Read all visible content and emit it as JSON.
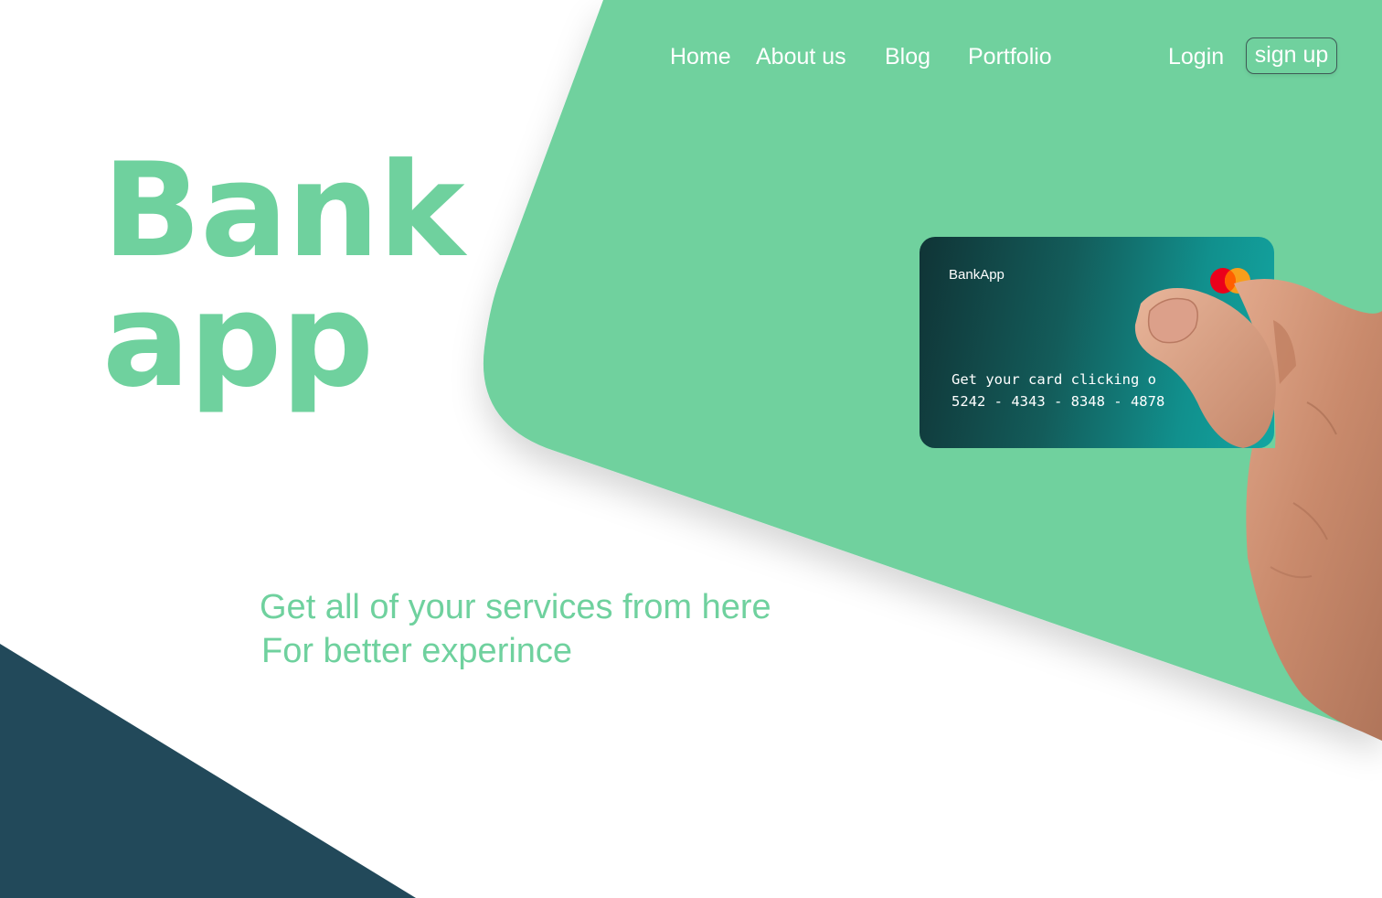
{
  "colors": {
    "accent_green": "#6fd19e",
    "dark_teal": "#22495a",
    "white": "#ffffff"
  },
  "nav": {
    "items": [
      {
        "label": "Home"
      },
      {
        "label": "About us"
      },
      {
        "label": "Blog"
      },
      {
        "label": "Portfolio"
      }
    ],
    "login_label": "Login",
    "signup_label": "sign up"
  },
  "hero": {
    "title_line1": "Bank",
    "title_line2": "app",
    "tagline_line1": "Get all of your services from here",
    "tagline_line2": "For better experince"
  },
  "card": {
    "brand": "BankApp",
    "text_line1": "Get your card clicking o",
    "number": "5242 - 4343 - 8348 - 4878",
    "network_icon": "mastercard-logo"
  }
}
